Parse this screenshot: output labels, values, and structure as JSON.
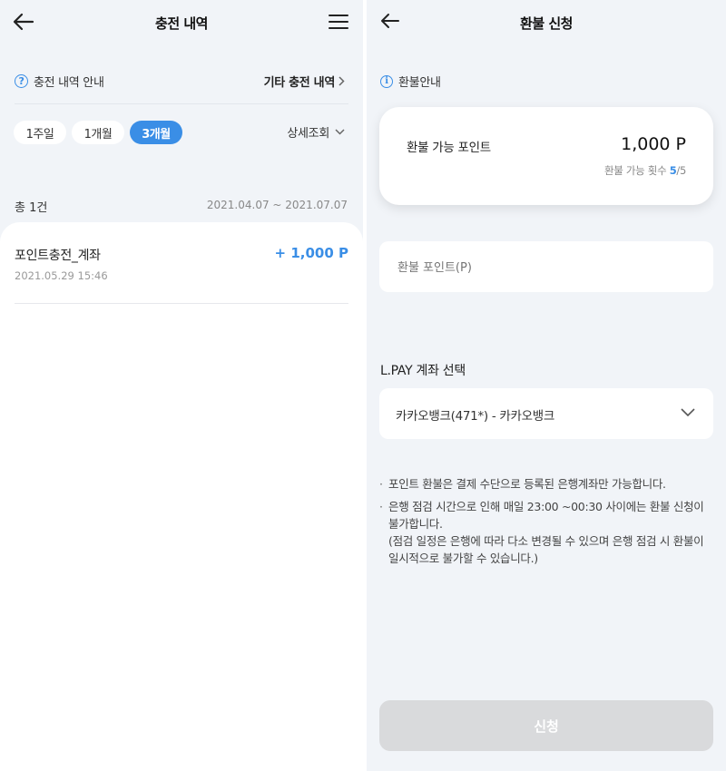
{
  "charge_history": {
    "title": "충전 내역",
    "guide_label": "충전 내역 안내",
    "other_link": "기타 충전 내역",
    "periods": [
      "1주일",
      "1개월",
      "3개월"
    ],
    "active_period": "3개월",
    "detail_label": "상세조회",
    "total_label": "총 1건",
    "date_range": "2021.04.07 ~ 2021.07.07",
    "transactions": [
      {
        "title": "포인트충전_계좌",
        "datetime": "2021.05.29  15:46",
        "amount": "+ 1,000 P"
      }
    ]
  },
  "refund": {
    "title": "환불 신청",
    "guide_label": "환불안내",
    "available_label": "환불 가능 포인트",
    "available_value": "1,000 P",
    "count_label": "환불 가능 횟수",
    "count_current": "5",
    "count_total": "/5",
    "amount_placeholder": "환불 포인트(P)",
    "account_section_label": "L.PAY 계좌 선택",
    "selected_account": "카카오뱅크(471*) - 카카오뱅크",
    "notes": [
      "포인트 환불은 결제 수단으로 등록된 은행계좌만 가능합니다.",
      "은행 점검 시간으로 인해 매일 23:00 ~00:30 사이에는 환불 신청이 불가합니다.",
      "(점검 일정은 은행에 따라 다소 변경될 수 있으며 은행 점검 시 환불이 일시적으로 불가할 수 있습니다.)"
    ],
    "submit_label": "신청"
  },
  "colors": {
    "accent": "#3a8ee6",
    "background": "#f1f4f8",
    "disabled_button": "#d9dadc"
  },
  "icons": [
    "back-arrow-icon",
    "hamburger-menu-icon",
    "question-circle-icon",
    "chevron-right-icon",
    "chevron-down-icon",
    "info-circle-icon"
  ]
}
